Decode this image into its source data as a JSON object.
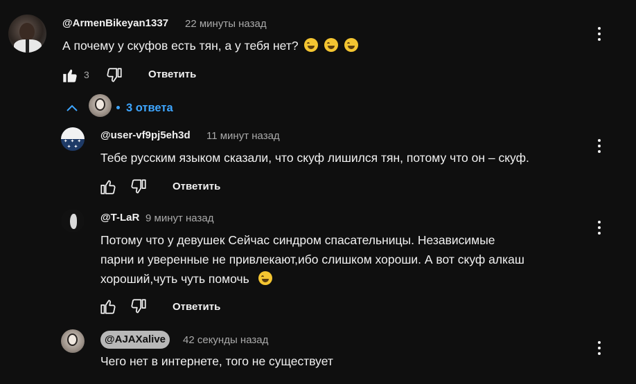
{
  "main_comment": {
    "author": "@ArmenBikeyan1337",
    "time": "22 минуты назад",
    "text": "А почему у скуфов есть тян, а у тебя нет?",
    "likes": "3",
    "reply_label": "Ответить",
    "avatar_icon": "avatar-man-suit-icon"
  },
  "replies_toggle": {
    "count_label": "3 ответа",
    "accent_color": "#3ea6ff"
  },
  "replies": [
    {
      "author": "@user-vf9pj5eh3d",
      "time": "11 минут назад",
      "text": "Тебе русским языком сказали, что скуф лишился тян, потому что он – скуф.",
      "reply_label": "Ответить"
    },
    {
      "author": "@T-LaR",
      "time": "9 минут назад",
      "text_lines": [
        "Потому что у девушек Сейчас синдром спасательницы. Независимые",
        "парни и уверенные не привлекают,ибо слишком хороши. А вот скуф алкаш",
        "хороший,чуть чуть помочь"
      ],
      "reply_label": "Ответить"
    },
    {
      "author": "@AJAXalive",
      "time": "42 секунды назад",
      "text": "Чего нет в интернете, того не существует"
    }
  ],
  "colors": {
    "background": "#0f0f0f",
    "text": "#f1f1f1",
    "muted": "#aaaaaa"
  }
}
